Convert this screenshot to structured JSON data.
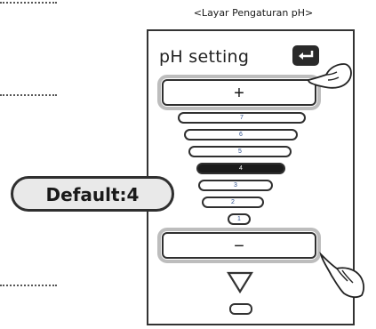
{
  "caption": "<Layar Pengaturan pH>",
  "panel": {
    "title": "pH setting",
    "return_icon": "return-arrow-icon",
    "plus_label": "+",
    "minus_label": "−",
    "levels": [
      {
        "label": "7",
        "active": false
      },
      {
        "label": "6",
        "active": false
      },
      {
        "label": "5",
        "active": false
      },
      {
        "label": "4",
        "active": true
      },
      {
        "label": "3",
        "active": false
      },
      {
        "label": "2",
        "active": false
      },
      {
        "label": "1",
        "active": false
      }
    ],
    "down_icon": "triangle-down-icon"
  },
  "default_badge": "Default:4",
  "colors": {
    "active_bar": "#1b1b1b",
    "outline": "#2f2f2f",
    "badge_bg": "#e9e9e9"
  }
}
